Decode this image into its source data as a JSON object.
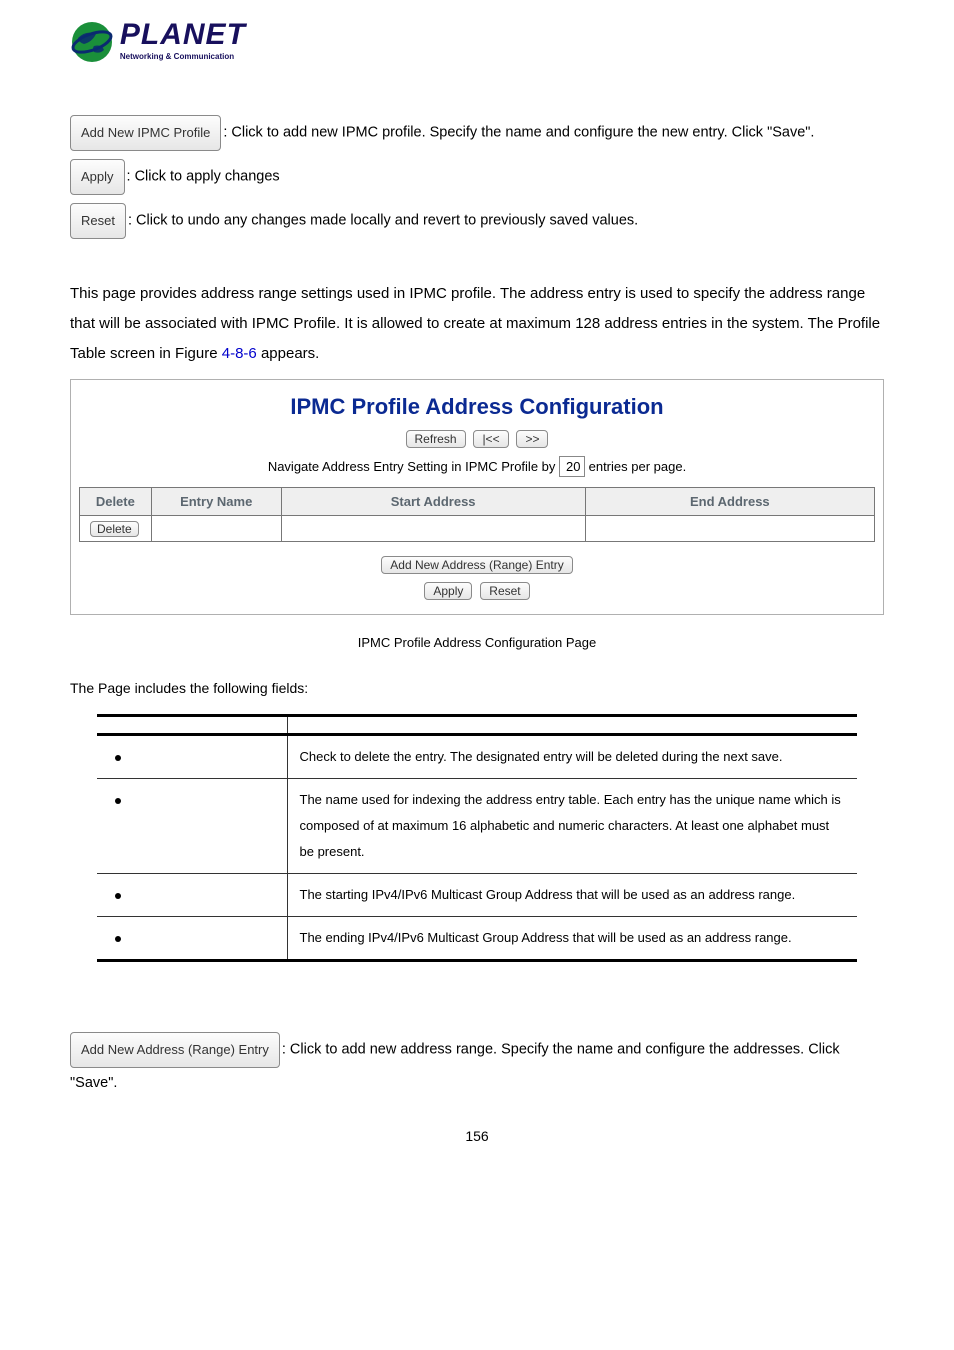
{
  "logo": {
    "name": "PLANET",
    "tagline": "Networking & Communication"
  },
  "topButtons": {
    "addProfile": {
      "label": "Add New IPMC Profile",
      "desc": ": Click to add new IPMC profile. Specify the name and configure the new entry. Click \"Save\"."
    },
    "apply": {
      "label": "Apply",
      "desc": ": Click to apply changes"
    },
    "reset": {
      "label": "Reset",
      "desc": ": Click to undo any changes made locally and revert to previously saved values."
    }
  },
  "intro": {
    "p1a": "This page provides address range settings used in ",
    "p1b": "IPMC profile",
    "p1c": ". The address entry is used to specify the address range that will be associated with ",
    "p1d": "IPMC",
    "p1e": " Profile. It is allowed to create at maximum 128 address entries in the system. ",
    "p1f": "The Profile Table screen in Figure ",
    "figref": "4-8-6",
    "p1g": " appears."
  },
  "panel": {
    "title": "IPMC Profile Address Configuration",
    "refresh": "Refresh",
    "first": "|<<",
    "next": ">>",
    "navPrefix": "Navigate Address Entry Setting in IPMC Profile by ",
    "navValue": "20",
    "navSuffix": " entries per page.",
    "headers": {
      "delete": "Delete",
      "entryName": "Entry Name",
      "startAddr": "Start Address",
      "endAddr": "End Address"
    },
    "row": {
      "delete": "Delete"
    },
    "addEntry": "Add New Address (Range) Entry",
    "apply": "Apply",
    "reset": "Reset"
  },
  "caption": "IPMC Profile Address Configuration Page",
  "fieldsIntro": "The Page includes the following fields:",
  "fieldsTable": {
    "rows": [
      {
        "desc": "Check to delete the entry.\nThe designated entry will be deleted during the next save."
      },
      {
        "desc": "The name used for indexing the address entry table.\nEach entry has the unique name which is composed of at maximum 16 alphabetic and numeric characters. At least one alphabet must be present."
      },
      {
        "desc": "The starting IPv4/IPv6 Multicast Group Address that will be used as an address range."
      },
      {
        "desc": "The ending IPv4/IPv6 Multicast Group Address that will be used as an address range."
      }
    ]
  },
  "footer": {
    "addRange": {
      "label": "Add New Address (Range) Entry",
      "desc": ": Click to add new address range. Specify the name and configure the addresses. Click \"Save"
    },
    "descTail": "\"."
  },
  "pageNum": "156"
}
